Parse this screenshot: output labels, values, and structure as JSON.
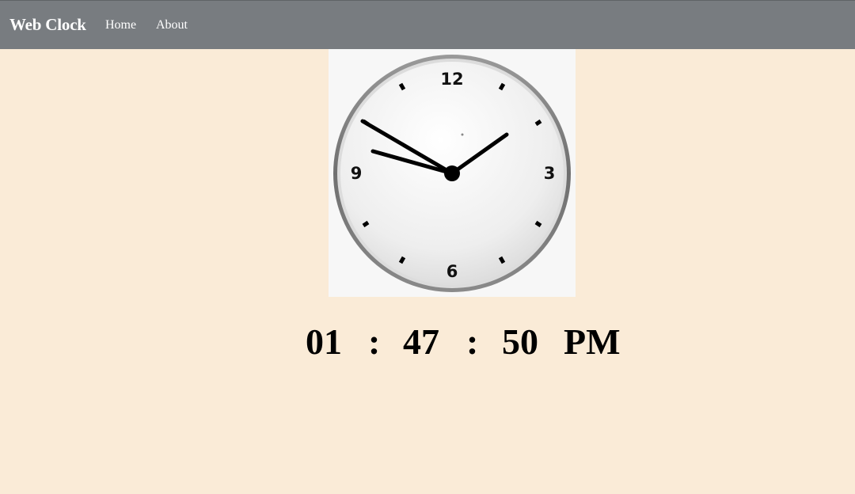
{
  "navbar": {
    "brand": "Web Clock",
    "links": [
      {
        "label": "Home"
      },
      {
        "label": "About"
      }
    ],
    "background": "#787c80"
  },
  "page": {
    "background": "#faebd7"
  },
  "clock": {
    "numerals": {
      "top": "12",
      "right": "3",
      "bottom": "6",
      "left": "9"
    },
    "hands_color": "#000000"
  },
  "digital_time": {
    "hours": "01",
    "separator": ":",
    "minutes": "47",
    "seconds": "50",
    "period": "PM"
  }
}
